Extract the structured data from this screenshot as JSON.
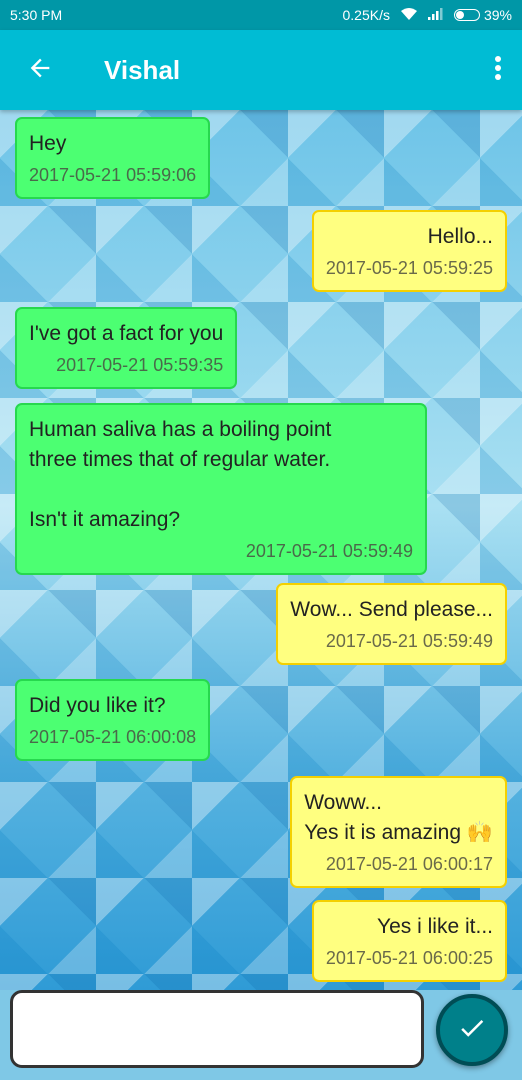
{
  "status_bar": {
    "time": "5:30 PM",
    "network_speed": "0.25K/s",
    "battery": "39%",
    "battery_level": 0.39,
    "icons": [
      "wifi-icon",
      "signal-icon",
      "battery-icon"
    ]
  },
  "header": {
    "title": "Vishal",
    "back_icon": "arrow-left-icon",
    "menu_icon": "more-vert-icon"
  },
  "messages": [
    {
      "direction": "in",
      "text": "Hey",
      "time": "2017-05-21 05:59:06"
    },
    {
      "direction": "out",
      "text": "Hello...",
      "time": "2017-05-21 05:59:25"
    },
    {
      "direction": "in",
      "text": "I've got a fact for you",
      "time": "2017-05-21 05:59:35"
    },
    {
      "direction": "in",
      "text": "Human saliva has a boiling point\nthree times that of regular water.\n\nIsn't it amazing?",
      "time": "2017-05-21 05:59:49"
    },
    {
      "direction": "out",
      "text": "Wow... Send please...",
      "time": "2017-05-21 05:59:49"
    },
    {
      "direction": "in",
      "text": "Did you like it?",
      "time": "2017-05-21 06:00:08"
    },
    {
      "direction": "out",
      "text": "Woww...\nYes it is amazing 🙌",
      "time": "2017-05-21 06:00:17"
    },
    {
      "direction": "out",
      "text": "Yes i like it...",
      "time": "2017-05-21 06:00:25"
    }
  ],
  "composer": {
    "value": "",
    "placeholder": "",
    "send_icon": "check-icon"
  },
  "colors": {
    "app_bar": "#00bcd4",
    "status_bar": "#0097a7",
    "incoming_bubble": "#4cff72",
    "outgoing_bubble": "#ffff80",
    "send_button": "#00808a"
  }
}
